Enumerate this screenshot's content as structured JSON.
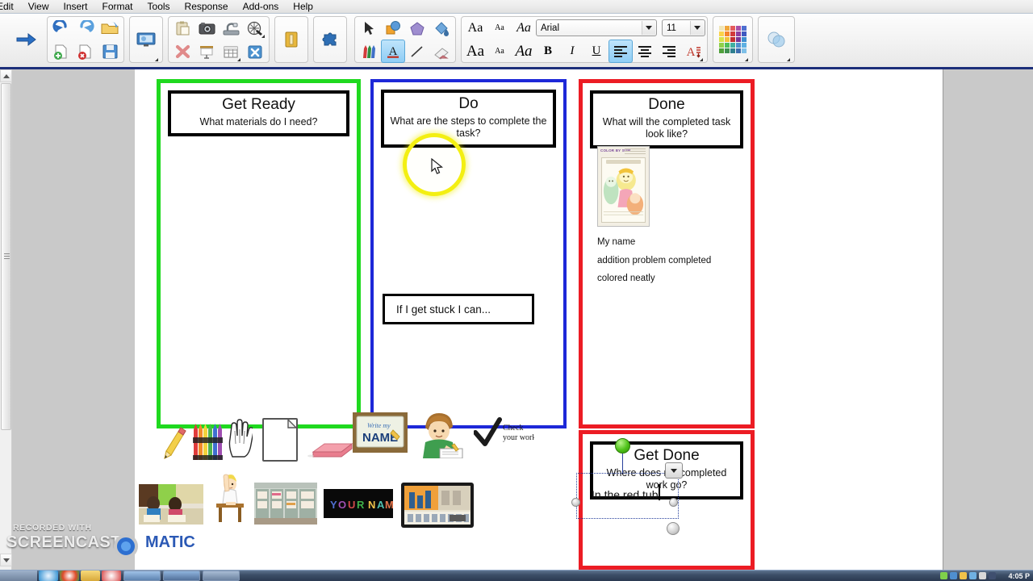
{
  "menubar": {
    "items": [
      {
        "label": "Edit"
      },
      {
        "label": "View"
      },
      {
        "label": "Insert"
      },
      {
        "label": "Format"
      },
      {
        "label": "Tools"
      },
      {
        "label": "Response"
      },
      {
        "label": "Add-ons"
      },
      {
        "label": "Help"
      }
    ]
  },
  "toolbar": {
    "font_name": "Arial",
    "font_size": "11",
    "buttons": {
      "go": "go-arrow",
      "undo": "undo",
      "redo": "redo",
      "open": "open-folder",
      "new": "new-page",
      "delete_page": "delete-page",
      "save": "save",
      "presentation": "presentation-monitor",
      "paste": "paste",
      "camera": "camera",
      "scanner": "scanner",
      "record": "record-audio",
      "cut": "delete-x",
      "screen": "screen",
      "table": "table",
      "wizard": "wizard",
      "book": "book",
      "addon": "puzzle-addon",
      "select": "select-arrow",
      "shape": "shape",
      "polygon": "polygon",
      "fill": "paint-bucket",
      "pens": "pens",
      "text": "text-tool",
      "line": "line-tool",
      "eraser": "eraser",
      "font_grow": "increase-font",
      "font_shrink": "decrease-font",
      "font_style": "font-style",
      "font_grow2": "increase-font-2",
      "font_shrink2": "decrease-font-2",
      "font_style2": "font-style-2",
      "bold": "B",
      "italic": "I",
      "underline": "U",
      "align_left": "align-left",
      "align_center": "align-center",
      "align_right": "align-right",
      "text_color": "text-color",
      "palette": "color-palette",
      "transparency": "transparency"
    }
  },
  "canvas": {
    "panels": [
      {
        "id": "get-ready",
        "border_color": "#1fd91f",
        "title": "Get Ready",
        "subtitle": "What materials do I need?"
      },
      {
        "id": "do",
        "border_color": "#1d28d8",
        "title": "Do",
        "subtitle": "What are the steps to complete the task?"
      },
      {
        "id": "done",
        "border_color": "#ec1c24",
        "title": "Done",
        "subtitle": "What will the completed task look like?"
      },
      {
        "id": "get-done",
        "border_color": "#ec1c24",
        "title": "Get Done",
        "subtitle": "Where does my completed work go?"
      }
    ],
    "stuck_box": {
      "label": "If I get stuck I can..."
    },
    "done_checklist": [
      "My name",
      "addition problem completed",
      "colored neatly"
    ],
    "worksheet_thumbnail": {
      "heading": "COLOR BY SUM",
      "subheading": "COLOR THE PICTURE"
    },
    "clipart_row1": [
      {
        "name": "pencil"
      },
      {
        "name": "crayons"
      },
      {
        "name": "hand-sign"
      },
      {
        "name": "blank-paper"
      },
      {
        "name": "pink-eraser"
      },
      {
        "name": "write-my-name-card",
        "text1": "Write my",
        "text2": "NAME"
      },
      {
        "name": "boy-writing"
      },
      {
        "name": "check-your-work",
        "text1": "Check",
        "text2": "your work!"
      }
    ],
    "clipart_row2": [
      {
        "name": "students-working-photo"
      },
      {
        "name": "boy-raising-hand"
      },
      {
        "name": "classroom-shelves-photo"
      },
      {
        "name": "your-name-banner",
        "text": "YOUR NAME"
      },
      {
        "name": "classroom-board-photo"
      }
    ],
    "active_textbox": {
      "value": "In the red tub",
      "state": "editing"
    }
  },
  "watermark": {
    "line1": "RECORDED WITH",
    "line2": "SCREENCAST",
    "line3": "MATIC"
  },
  "taskbar": {
    "clock": "4:05 P"
  }
}
